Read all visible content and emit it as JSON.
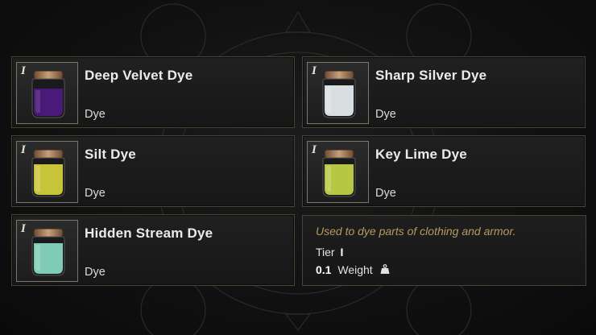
{
  "items": [
    {
      "name": "Deep Velvet Dye",
      "type": "Dye",
      "tier": "I",
      "color": "#4a1a78",
      "highlight": "#6b2aa6"
    },
    {
      "name": "Sharp Silver Dye",
      "type": "Dye",
      "tier": "I",
      "color": "#d8dde0",
      "highlight": "#f2f4f5"
    },
    {
      "name": "Silt Dye",
      "type": "Dye",
      "tier": "I",
      "color": "#c7c43a",
      "highlight": "#e3df5a"
    },
    {
      "name": "Key Lime Dye",
      "type": "Dye",
      "tier": "I",
      "color": "#b6c843",
      "highlight": "#d2e06a"
    },
    {
      "name": "Hidden Stream Dye",
      "type": "Dye",
      "tier": "I",
      "color": "#7fcbb6",
      "highlight": "#a9e3d2"
    }
  ],
  "tooltip": {
    "description": "Used to dye parts of clothing and armor.",
    "tier_label": "Tier",
    "tier_value": "I",
    "weight_value": "0.1",
    "weight_label": "Weight",
    "weight_icon": "weight-icon"
  },
  "colors": {
    "border": "#4a4531",
    "description": "#b89a5e"
  }
}
